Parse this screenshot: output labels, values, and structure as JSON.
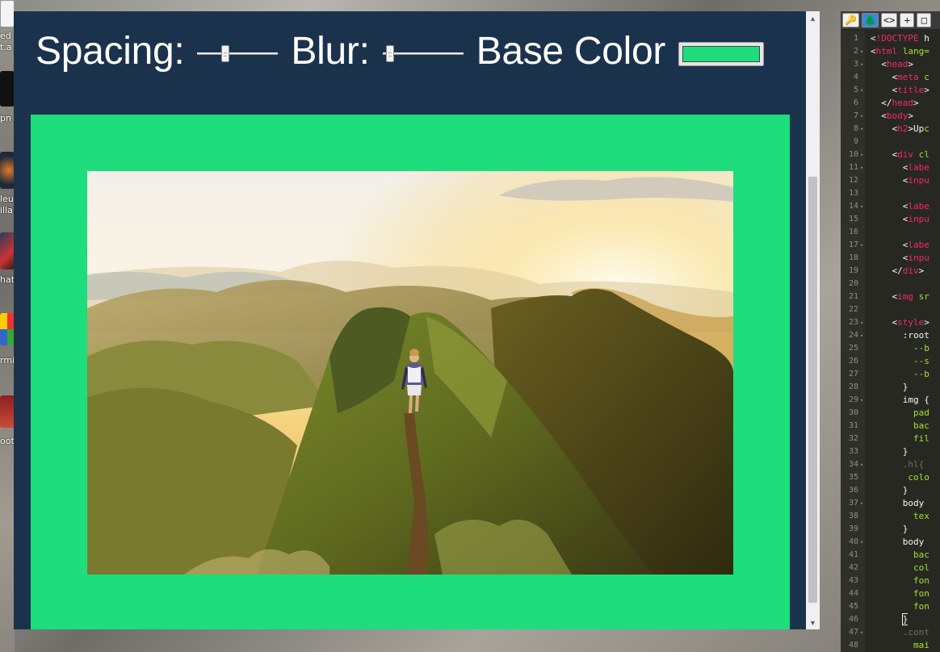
{
  "desktop": {
    "labels": [
      "ed",
      "t.a",
      "pn",
      "leu",
      "illa",
      "hat",
      "rmi",
      "oot"
    ]
  },
  "controls": {
    "spacing_label": "Spacing:",
    "spacing_value": 0.33,
    "blur_label": "Blur:",
    "blur_value": 0.05,
    "base_color_label": "Base Color",
    "base_color_value": "#1edd7d"
  },
  "colors": {
    "page_background": "#1b324c",
    "frame": "#1edd7d"
  },
  "photo": {
    "description_icon": "mountain-hiker-photo"
  },
  "editor": {
    "toolbar": [
      "🔑",
      "⚠",
      "🌲",
      "<>",
      "+",
      "□"
    ],
    "lines": [
      {
        "n": "1",
        "fold": "",
        "code": "<!DOCTYPE h"
      },
      {
        "n": "2",
        "fold": "▾",
        "code": "<html lang="
      },
      {
        "n": "3",
        "fold": "▾",
        "code": "  <head>"
      },
      {
        "n": "4",
        "fold": "",
        "code": "    <meta c"
      },
      {
        "n": "5",
        "fold": "▾",
        "code": "    <title>"
      },
      {
        "n": "6",
        "fold": "",
        "code": "  </head>"
      },
      {
        "n": "7",
        "fold": "▾",
        "code": "  <body>"
      },
      {
        "n": "8",
        "fold": "▾",
        "code": "    <h2>Upc"
      },
      {
        "n": "9",
        "fold": "",
        "code": ""
      },
      {
        "n": "10",
        "fold": "▾",
        "code": "    <div cl"
      },
      {
        "n": "11",
        "fold": "▾",
        "code": "      <labe"
      },
      {
        "n": "12",
        "fold": "",
        "code": "      <inpu"
      },
      {
        "n": "13",
        "fold": "",
        "code": ""
      },
      {
        "n": "14",
        "fold": "▾",
        "code": "      <labe"
      },
      {
        "n": "15",
        "fold": "",
        "code": "      <inpu"
      },
      {
        "n": "16",
        "fold": "",
        "code": ""
      },
      {
        "n": "17",
        "fold": "▾",
        "code": "      <labe"
      },
      {
        "n": "18",
        "fold": "",
        "code": "      <inpu"
      },
      {
        "n": "19",
        "fold": "",
        "code": "    </div>"
      },
      {
        "n": "20",
        "fold": "",
        "code": ""
      },
      {
        "n": "21",
        "fold": "",
        "code": "    <img sr"
      },
      {
        "n": "22",
        "fold": "",
        "code": ""
      },
      {
        "n": "23",
        "fold": "▾",
        "code": "    <style>"
      },
      {
        "n": "24",
        "fold": "▾",
        "code": "      :root"
      },
      {
        "n": "25",
        "fold": "",
        "code": "        --b"
      },
      {
        "n": "26",
        "fold": "",
        "code": "        --s"
      },
      {
        "n": "27",
        "fold": "",
        "code": "        --b"
      },
      {
        "n": "28",
        "fold": "",
        "code": "      }"
      },
      {
        "n": "29",
        "fold": "▾",
        "code": "      img {"
      },
      {
        "n": "30",
        "fold": "",
        "code": "        pad"
      },
      {
        "n": "31",
        "fold": "",
        "code": "        bac"
      },
      {
        "n": "32",
        "fold": "",
        "code": "        fil"
      },
      {
        "n": "33",
        "fold": "",
        "code": "      }"
      },
      {
        "n": "34",
        "fold": "▾",
        "code": "      .hl{"
      },
      {
        "n": "35",
        "fold": "",
        "code": "       colo"
      },
      {
        "n": "36",
        "fold": "",
        "code": "      }"
      },
      {
        "n": "37",
        "fold": "▾",
        "code": "      body"
      },
      {
        "n": "38",
        "fold": "",
        "code": "        tex"
      },
      {
        "n": "39",
        "fold": "",
        "code": "      }"
      },
      {
        "n": "40",
        "fold": "▾",
        "code": "      body"
      },
      {
        "n": "41",
        "fold": "",
        "code": "        bac"
      },
      {
        "n": "42",
        "fold": "",
        "code": "        col"
      },
      {
        "n": "43",
        "fold": "",
        "code": "        fon"
      },
      {
        "n": "44",
        "fold": "",
        "code": "        fon"
      },
      {
        "n": "45",
        "fold": "",
        "code": "        fon"
      },
      {
        "n": "46",
        "fold": "",
        "code": "      }"
      },
      {
        "n": "47",
        "fold": "▾",
        "code": "      .cont"
      },
      {
        "n": "48",
        "fold": "",
        "code": "        mai"
      }
    ]
  }
}
